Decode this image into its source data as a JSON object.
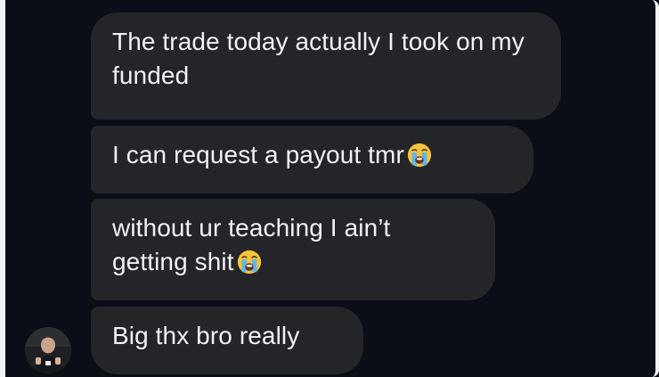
{
  "conversation": {
    "messages": [
      {
        "text": "The trade today actually I took on my funded",
        "emoji": ""
      },
      {
        "text": "I can request a payout tmr",
        "emoji": "loudly-crying-face"
      },
      {
        "text": "without ur teaching I ain’t getting shit",
        "emoji": "loudly-crying-face"
      },
      {
        "text": "Big thx bro really",
        "emoji": ""
      }
    ]
  },
  "colors": {
    "background": "#0b0e17",
    "bubble": "#242529",
    "text": "#f2f2f4"
  }
}
